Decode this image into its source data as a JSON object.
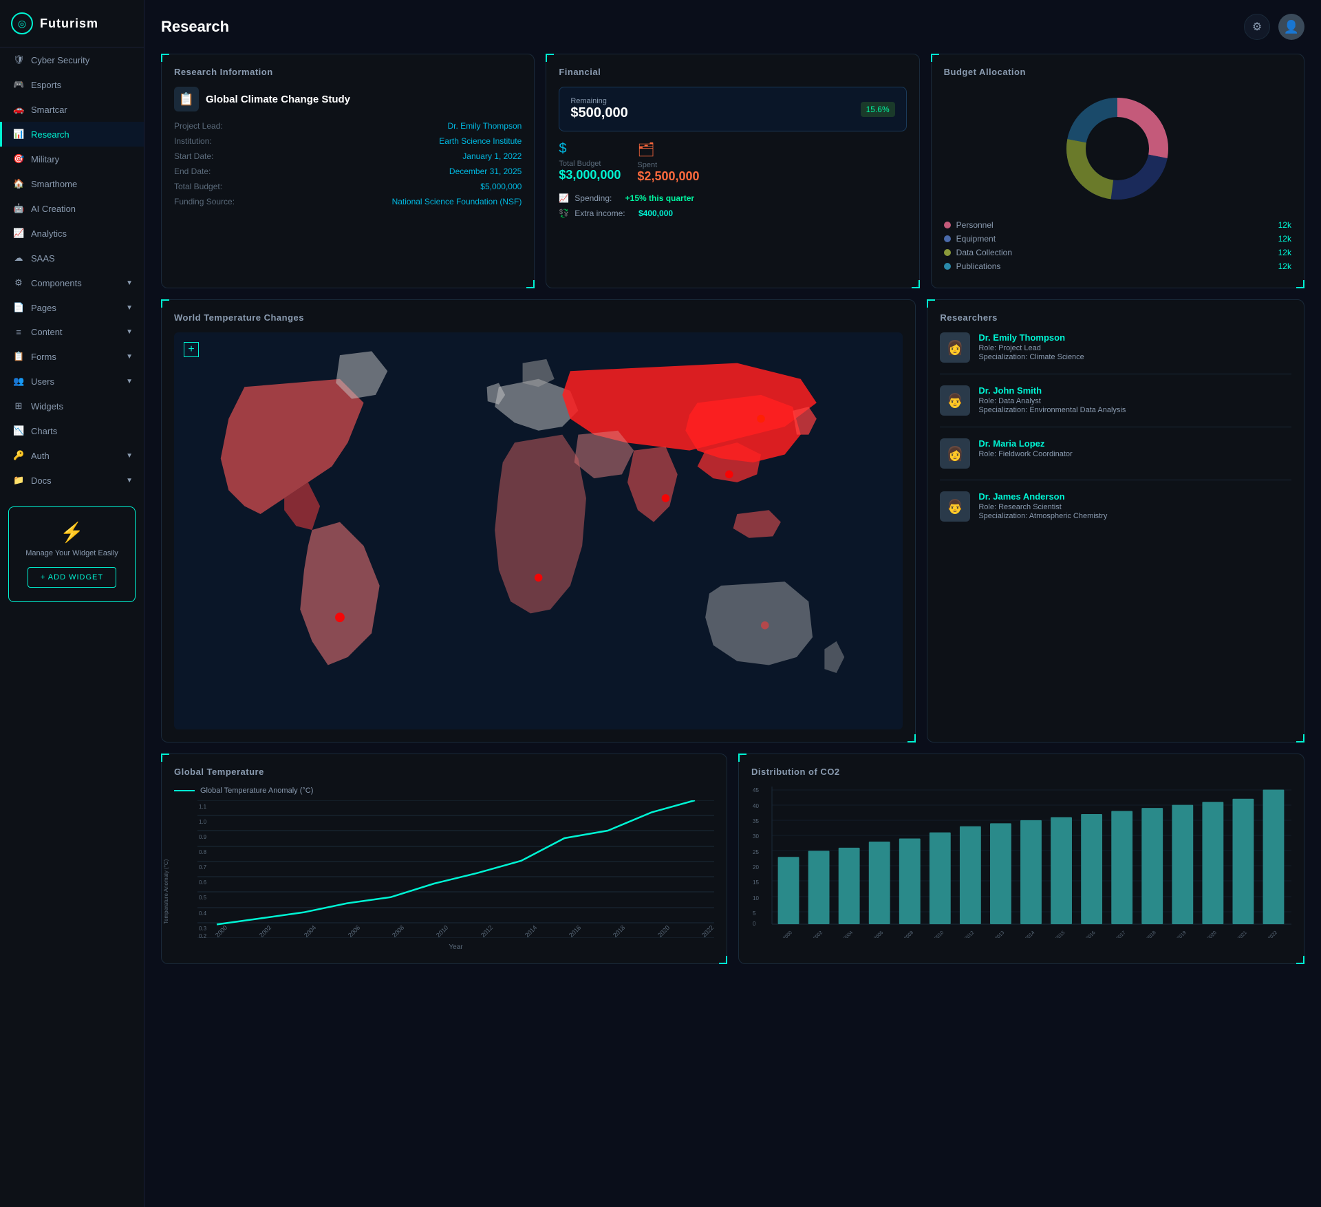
{
  "app": {
    "name": "Futurism"
  },
  "sidebar": {
    "items": [
      {
        "id": "cyber-security",
        "label": "Cyber Security",
        "icon": "🛡",
        "hasChevron": false,
        "active": false
      },
      {
        "id": "esports",
        "label": "Esports",
        "icon": "🎮",
        "hasChevron": false,
        "active": false
      },
      {
        "id": "smartcar",
        "label": "Smartcar",
        "icon": "🚗",
        "hasChevron": false,
        "active": false
      },
      {
        "id": "research",
        "label": "Research",
        "icon": "📊",
        "hasChevron": false,
        "active": true
      },
      {
        "id": "military",
        "label": "Military",
        "icon": "🎯",
        "hasChevron": false,
        "active": false
      },
      {
        "id": "smarthome",
        "label": "Smarthome",
        "icon": "🏠",
        "hasChevron": false,
        "active": false
      },
      {
        "id": "ai-creation",
        "label": "AI Creation",
        "icon": "🤖",
        "hasChevron": false,
        "active": false
      },
      {
        "id": "analytics",
        "label": "Analytics",
        "icon": "📈",
        "hasChevron": false,
        "active": false
      },
      {
        "id": "saas",
        "label": "SAAS",
        "icon": "☁",
        "hasChevron": false,
        "active": false
      },
      {
        "id": "components",
        "label": "Components",
        "icon": "⚙",
        "hasChevron": true,
        "active": false
      },
      {
        "id": "pages",
        "label": "Pages",
        "icon": "📄",
        "hasChevron": true,
        "active": false
      },
      {
        "id": "content",
        "label": "Content",
        "icon": "≡",
        "hasChevron": true,
        "active": false
      },
      {
        "id": "forms",
        "label": "Forms",
        "icon": "📋",
        "hasChevron": true,
        "active": false
      },
      {
        "id": "users",
        "label": "Users",
        "icon": "👥",
        "hasChevron": true,
        "active": false
      },
      {
        "id": "widgets",
        "label": "Widgets",
        "icon": "⊞",
        "hasChevron": false,
        "active": false
      },
      {
        "id": "charts",
        "label": "Charts",
        "icon": "📉",
        "hasChevron": false,
        "active": false
      },
      {
        "id": "auth",
        "label": "Auth",
        "icon": "🔑",
        "hasChevron": true,
        "active": false
      },
      {
        "id": "docs",
        "label": "Docs",
        "icon": "📁",
        "hasChevron": true,
        "active": false
      }
    ],
    "widget": {
      "icon": "⚡",
      "text": "Manage Your Widget Easily",
      "button_label": "+ ADD WIDGET"
    }
  },
  "header": {
    "title": "Research",
    "settings_label": "settings",
    "avatar_label": "user avatar"
  },
  "research_info": {
    "card_title": "Research Information",
    "project_icon": "📋",
    "project_name": "Global Climate Change Study",
    "fields": [
      {
        "label": "Project Lead:",
        "value": "Dr. Emily Thompson"
      },
      {
        "label": "Institution:",
        "value": "Earth Science Institute"
      },
      {
        "label": "Start Date:",
        "value": "January 1, 2022"
      },
      {
        "label": "End Date:",
        "value": "December 31, 2025"
      },
      {
        "label": "Total Budget:",
        "value": "$5,000,000"
      },
      {
        "label": "Funding Source:",
        "value": "National Science Foundation (NSF)"
      }
    ]
  },
  "financial": {
    "card_title": "Financial",
    "remaining_label": "Remaining",
    "remaining_amount": "$500,000",
    "remaining_pct": "15.6%",
    "total_budget_label": "Total Budget",
    "total_budget_value": "$3,000,000",
    "spent_label": "Spent",
    "spent_value": "$2,500,000",
    "spending_label": "Spending:",
    "spending_value": "+15% this quarter",
    "extra_income_label": "Extra income:",
    "extra_income_value": "$400,000"
  },
  "budget": {
    "card_title": "Budget Allocation",
    "legend": [
      {
        "label": "Personnel",
        "value": "12k",
        "color": "#c45a7a"
      },
      {
        "label": "Equipment",
        "value": "12k",
        "color": "#4a6aaa"
      },
      {
        "label": "Data Collection",
        "value": "12k",
        "color": "#8a9a3a"
      },
      {
        "label": "Publications",
        "value": "12k",
        "color": "#2a8aaa"
      }
    ],
    "donut_segments": [
      {
        "label": "Personnel",
        "pct": 28,
        "color": "#c45a7a"
      },
      {
        "label": "Equipment",
        "pct": 24,
        "color": "#1a2a5a"
      },
      {
        "label": "Data Collection",
        "pct": 26,
        "color": "#6a7a2a"
      },
      {
        "label": "Publications",
        "pct": 22,
        "color": "#1a3a5a"
      }
    ]
  },
  "world_map": {
    "card_title": "World Temperature Changes"
  },
  "researchers": {
    "card_title": "Researchers",
    "list": [
      {
        "name": "Dr. Emily Thompson",
        "role": "Role: Project Lead",
        "specialization": "Specialization: Climate Science",
        "avatar": "👩"
      },
      {
        "name": "Dr. John Smith",
        "role": "Role: Data Analyst",
        "specialization": "Specialization: Environmental Data Analysis",
        "avatar": "👨"
      },
      {
        "name": "Dr. Maria Lopez",
        "role": "Role: Fieldwork Coordinator",
        "specialization": "",
        "avatar": "👩"
      },
      {
        "name": "Dr. James Anderson",
        "role": "Role: Research Scientist",
        "specialization": "Specialization: Atmospheric Chemistry",
        "avatar": "👨"
      }
    ]
  },
  "global_temp": {
    "card_title": "Global Temperature",
    "legend_label": "Global Temperature Anomaly (°C)",
    "y_axis_label": "Temperature Anomaly (°C)",
    "x_axis_label": "Year",
    "data": [
      {
        "year": "2000",
        "value": 0.28
      },
      {
        "year": "2002",
        "value": 0.32
      },
      {
        "year": "2004",
        "value": 0.36
      },
      {
        "year": "2006",
        "value": 0.42
      },
      {
        "year": "2008",
        "value": 0.46
      },
      {
        "year": "2010",
        "value": 0.55
      },
      {
        "year": "2012",
        "value": 0.62
      },
      {
        "year": "2014",
        "value": 0.7
      },
      {
        "year": "2016",
        "value": 0.85
      },
      {
        "year": "2018",
        "value": 0.9
      },
      {
        "year": "2020",
        "value": 1.02
      },
      {
        "year": "2022",
        "value": 1.1
      }
    ],
    "y_min": 0.2,
    "y_max": 1.1,
    "y_labels": [
      "1.1",
      "1.0",
      "0.9",
      "0.8",
      "0.7",
      "0.6",
      "0.5",
      "0.4",
      "0.3",
      "0.2"
    ]
  },
  "co2": {
    "card_title": "Distribution of CO2",
    "data": [
      {
        "year": "2000",
        "value": 22
      },
      {
        "year": "2002",
        "value": 24
      },
      {
        "year": "2004",
        "value": 25
      },
      {
        "year": "2006",
        "value": 27
      },
      {
        "year": "2008",
        "value": 28
      },
      {
        "year": "2010",
        "value": 30
      },
      {
        "year": "2012",
        "value": 32
      },
      {
        "year": "2013",
        "value": 33
      },
      {
        "year": "2014",
        "value": 34
      },
      {
        "year": "2015",
        "value": 35
      },
      {
        "year": "2016",
        "value": 36
      },
      {
        "year": "2017",
        "value": 37
      },
      {
        "year": "2018",
        "value": 38
      },
      {
        "year": "2019",
        "value": 39
      },
      {
        "year": "2020",
        "value": 40
      },
      {
        "year": "2021",
        "value": 41
      },
      {
        "year": "2022",
        "value": 44
      }
    ],
    "y_labels": [
      "45",
      "40",
      "35",
      "30",
      "25",
      "20",
      "15",
      "10",
      "5",
      "0"
    ]
  }
}
